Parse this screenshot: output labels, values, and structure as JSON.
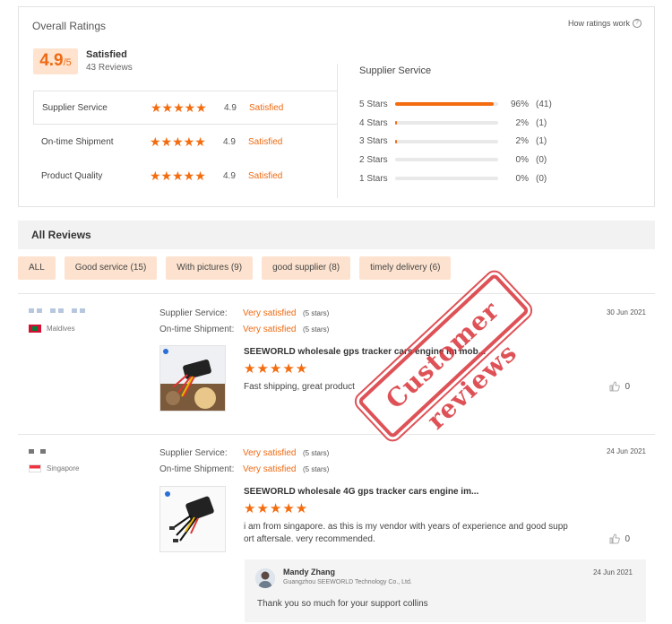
{
  "ratings": {
    "title": "Overall Ratings",
    "how_link": "How ratings work",
    "score": "4.9",
    "score_den": "/5",
    "level": "Satisfied",
    "count": "43 Reviews",
    "rows": [
      {
        "name": "Supplier Service",
        "value": "4.9",
        "level": "Satisfied",
        "stars": 5
      },
      {
        "name": "On-time Shipment",
        "value": "4.9",
        "level": "Satisfied",
        "stars": 5
      },
      {
        "name": "Product Quality",
        "value": "4.9",
        "level": "Satisfied",
        "stars": 5
      }
    ],
    "supplier_title": "Supplier Service",
    "distribution": [
      {
        "label": "5 Stars",
        "pct": "96%",
        "count": "(41)",
        "fraction": 0.96
      },
      {
        "label": "4 Stars",
        "pct": "2%",
        "count": "(1)",
        "fraction": 0.02
      },
      {
        "label": "3 Stars",
        "pct": "2%",
        "count": "(1)",
        "fraction": 0.02
      },
      {
        "label": "2 Stars",
        "pct": "0%",
        "count": "(0)",
        "fraction": 0
      },
      {
        "label": "1 Stars",
        "pct": "0%",
        "count": "(0)",
        "fraction": 0
      }
    ],
    "accent_color": "#f36c0f"
  },
  "reviews_header": "All Reviews",
  "filters": [
    "ALL",
    "Good service (15)",
    "With pictures (9)",
    "good supplier (8)",
    "timely delivery (6)"
  ],
  "reviews": [
    {
      "country": "Maldives",
      "service_label": "Supplier Service:",
      "service_value": "Very satisfied",
      "service_stars": "(5 stars)",
      "shipment_label": "On-time Shipment:",
      "shipment_value": "Very satisfied",
      "shipment_stars": "(5 stars)",
      "date": "30 Jun 2021",
      "product": "SEEWORLD wholesale gps tracker cars engine im mob...",
      "text": "Fast shipping, great product",
      "likes": "0",
      "stars": 5
    },
    {
      "country": "Singapore",
      "service_label": "Supplier Service:",
      "service_value": "Very satisfied",
      "service_stars": "(5 stars)",
      "shipment_label": "On-time Shipment:",
      "shipment_value": "Very satisfied",
      "shipment_stars": "(5 stars)",
      "date": "24 Jun 2021",
      "product": "SEEWORLD wholesale 4G gps tracker cars engine im...",
      "text": "i am from singapore. as this is my vendor with years of experience and good supp ort aftersale. very recommended.",
      "likes": "0",
      "stars": 5,
      "reply": {
        "name": "Mandy Zhang",
        "company": "Guangzhou SEEWORLD Technology Co., Ltd.",
        "date": "24 Jun 2021",
        "text": "Thank you so much  for your support collins"
      }
    }
  ],
  "stamp_text": "Customer reviews"
}
